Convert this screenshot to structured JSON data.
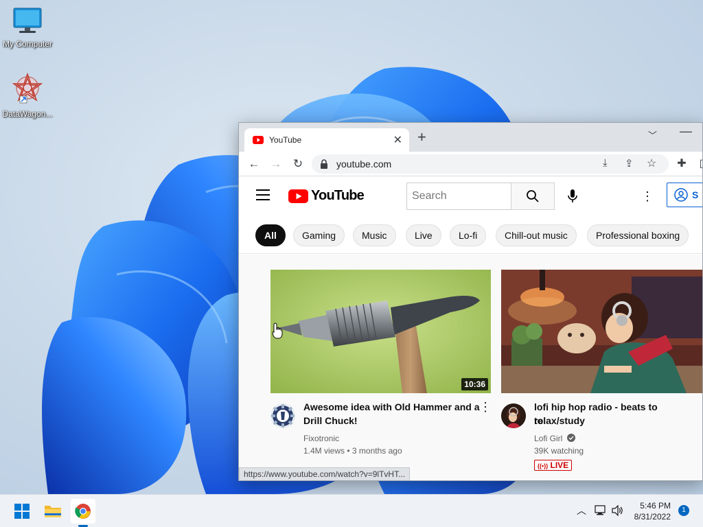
{
  "desktop": {
    "icons": [
      {
        "label": "My Computer",
        "icon": "monitor-icon"
      },
      {
        "label": "DataWagon...",
        "icon": "datawagon-icon"
      }
    ]
  },
  "browser": {
    "tab_title": "YouTube",
    "tab_close": "✕",
    "new_tab": "+",
    "url": "youtube.com",
    "status_url": "https://www.youtube.com/watch?v=9lTvHT..."
  },
  "youtube": {
    "logo_text": "YouTube",
    "search_placeholder": "Search",
    "signin_label": "S",
    "chips": [
      "All",
      "Gaming",
      "Music",
      "Live",
      "Lo-fi",
      "Chill-out music",
      "Professional boxing"
    ],
    "videos": [
      {
        "title_line1": "Awesome idea with Old Hammer and a",
        "title_line2": "Drill Chuck!",
        "channel": "Fixotronic",
        "views": "1.4M views",
        "separator": "•",
        "age": "3 months ago",
        "duration": "10:36"
      },
      {
        "title_line1": "lofi hip hop radio - beats to relax/study",
        "title_line2": "to",
        "channel": "Lofi Girl",
        "watching": "39K watching",
        "badge": "LIVE"
      }
    ]
  },
  "taskbar": {
    "time": "5:46 PM",
    "date": "8/31/2022",
    "notifications": "1"
  },
  "colors": {
    "youtube_red": "#ff0000",
    "accent_blue": "#065fd4",
    "live_red": "#cc0000"
  }
}
